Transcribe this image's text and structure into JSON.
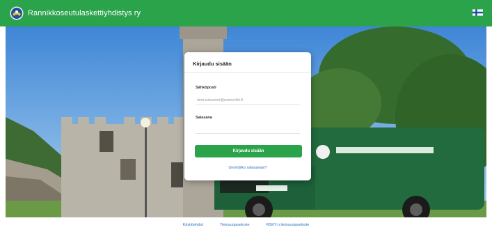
{
  "header": {
    "title": "Rannikkoseutulaskettiyhdistys ry",
    "logo_icon": "emblem-icon",
    "language_icon": "finnish-flag-icon",
    "background_color": "#2aa34a"
  },
  "login": {
    "title": "Kirjaudu sisään",
    "email_label": "Sähköposti",
    "email_placeholder": "nimi.sukunimi@esimerkki.fi",
    "password_label": "Salasana",
    "password_value": "",
    "submit_label": "Kirjaudu sisään",
    "forgot_link": "Unohditko salasanasi?",
    "accent_color": "#2aa34a"
  },
  "footer": {
    "links": [
      "Käyttöehdot",
      "Tietosuojaseloste",
      "RSKY:n tietosuojaseloste"
    ],
    "link_color": "#2c6fc4"
  }
}
